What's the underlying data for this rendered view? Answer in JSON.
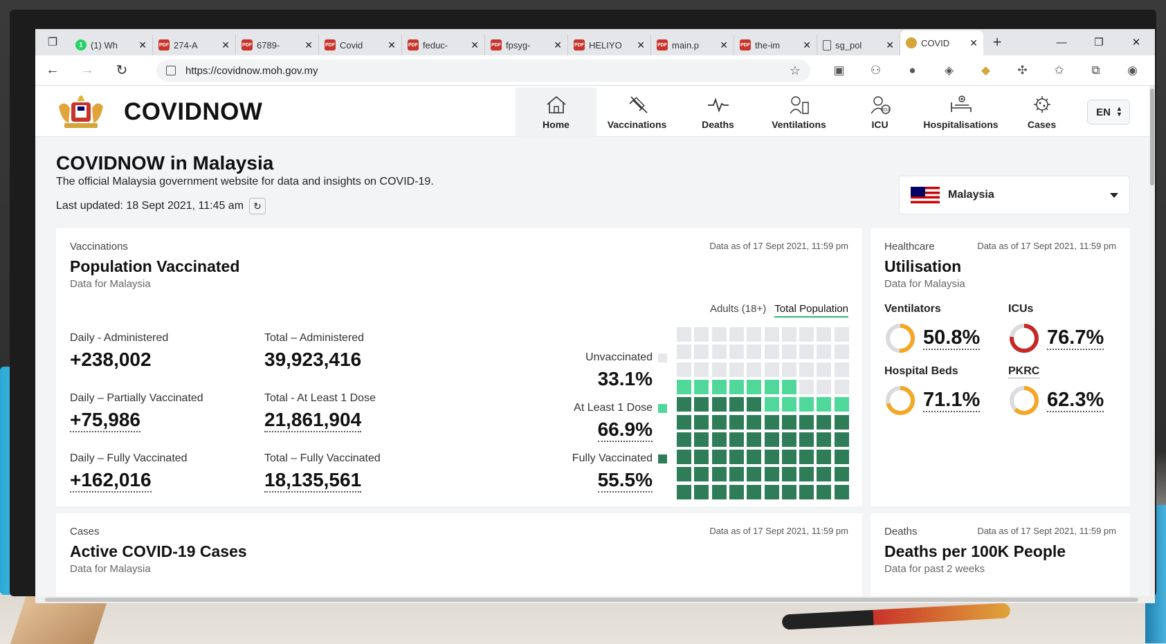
{
  "browser": {
    "tabs": [
      {
        "label": "(1) Wh",
        "icon": "whatsapp-icon"
      },
      {
        "label": "274-A",
        "icon": "pdf-icon"
      },
      {
        "label": "6789-",
        "icon": "pdf-icon"
      },
      {
        "label": "Covid",
        "icon": "pdf-icon"
      },
      {
        "label": "feduc-",
        "icon": "pdf-icon"
      },
      {
        "label": "fpsyg-",
        "icon": "pdf-icon"
      },
      {
        "label": "HELIYO",
        "icon": "pdf-icon"
      },
      {
        "label": "main.p",
        "icon": "pdf-icon"
      },
      {
        "label": "the-im",
        "icon": "pdf-icon"
      },
      {
        "label": "sg_pol",
        "icon": "document-icon"
      },
      {
        "label": "COVID",
        "icon": "covidnow-icon",
        "active": true
      }
    ],
    "url": "https://covidnow.moh.gov.my"
  },
  "site": {
    "brand": "COVIDNOW",
    "nav": [
      {
        "label": "Home",
        "icon": "home-icon",
        "active": true
      },
      {
        "label": "Vaccinations",
        "icon": "syringe-icon"
      },
      {
        "label": "Deaths",
        "icon": "pulse-icon"
      },
      {
        "label": "Ventilations",
        "icon": "ventilator-icon"
      },
      {
        "label": "ICU",
        "icon": "icu-icon"
      },
      {
        "label": "Hospitalisations",
        "icon": "hospital-bed-icon"
      },
      {
        "label": "Cases",
        "icon": "virus-icon"
      }
    ],
    "language": "EN"
  },
  "intro": {
    "title": "COVIDNOW in Malaysia",
    "description": "The official Malaysia government website for data and insights on COVID-19.",
    "last_updated": "Last updated: 18 Sept 2021, 11:45 am"
  },
  "country_selector": {
    "value": "Malaysia"
  },
  "vaccination_card": {
    "eyebrow": "Vaccinations",
    "title": "Population Vaccinated",
    "subtitle": "Data for Malaysia",
    "as_of": "Data as of 17 Sept 2021, 11:59 pm",
    "toggle": {
      "adults": "Adults (18+)",
      "total": "Total Population"
    },
    "stats": [
      {
        "label": "Daily - Administered",
        "value": "+238,002"
      },
      {
        "label": "Total – Administered",
        "value": "39,923,416"
      },
      {
        "label": "Daily – Partially Vaccinated",
        "value": "+75,986"
      },
      {
        "label": "Total - At Least 1 Dose",
        "value": "21,861,904"
      },
      {
        "label": "Daily – Fully Vaccinated",
        "value": "+162,016"
      },
      {
        "label": "Total – Fully Vaccinated",
        "value": "18,135,561"
      }
    ],
    "legend": [
      {
        "label": "Unvaccinated",
        "value": "33.1%",
        "color": "#e5e7eb"
      },
      {
        "label": "At Least 1 Dose",
        "value": "66.9%",
        "color": "#4fd89a"
      },
      {
        "label": "Fully Vaccinated",
        "value": "55.5%",
        "color": "#2e7d58"
      }
    ],
    "waffle": {
      "total_cells": 100,
      "fully_vaccinated_cells": 55,
      "at_least_one_dose_cells": 67
    }
  },
  "utilisation_card": {
    "eyebrow": "Healthcare",
    "title": "Utilisation",
    "subtitle": "Data for Malaysia",
    "as_of": "Data as of 17 Sept 2021, 11:59 pm",
    "items": [
      {
        "label": "Ventilators",
        "value": "50.8%",
        "fraction": 0.508,
        "color": "#f5a623"
      },
      {
        "label": "ICUs",
        "value": "76.7%",
        "fraction": 0.767,
        "color": "#c62828"
      },
      {
        "label": "Hospital Beds",
        "value": "71.1%",
        "fraction": 0.711,
        "color": "#f5a623"
      },
      {
        "label": "PKRC",
        "value": "62.3%",
        "fraction": 0.623,
        "color": "#f5a623"
      }
    ]
  },
  "cases_card": {
    "eyebrow": "Cases",
    "title": "Active COVID-19 Cases",
    "subtitle": "Data for Malaysia",
    "as_of": "Data as of 17 Sept 2021, 11:59 pm"
  },
  "deaths_card": {
    "eyebrow": "Deaths",
    "title": "Deaths per 100K People",
    "subtitle": "Data for past 2 weeks",
    "as_of": "Data as of 17 Sept 2021, 11:59 pm"
  }
}
